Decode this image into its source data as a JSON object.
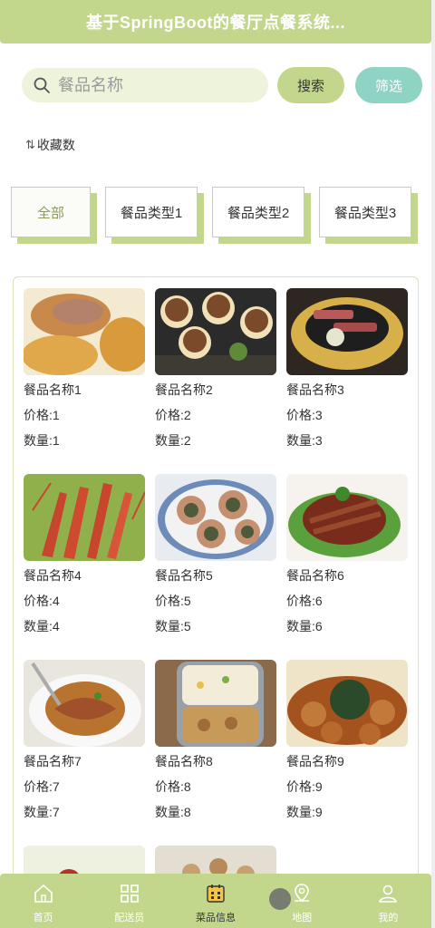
{
  "header": {
    "title": "基于SpringBoot的餐厅点餐系统..."
  },
  "search": {
    "placeholder": "餐品名称",
    "search_label": "搜索",
    "filter_label": "筛选"
  },
  "sort": {
    "label": "收藏数"
  },
  "tabs": [
    {
      "label": "全部",
      "active": true
    },
    {
      "label": "餐品类型1",
      "active": false
    },
    {
      "label": "餐品类型2",
      "active": false
    },
    {
      "label": "餐品类型3",
      "active": false
    }
  ],
  "dishes": [
    {
      "name": "餐品名称1",
      "price": "价格:1",
      "qty": "数量:1"
    },
    {
      "name": "餐品名称2",
      "price": "价格:2",
      "qty": "数量:2"
    },
    {
      "name": "餐品名称3",
      "price": "价格:3",
      "qty": "数量:3"
    },
    {
      "name": "餐品名称4",
      "price": "价格:4",
      "qty": "数量:4"
    },
    {
      "name": "餐品名称5",
      "price": "价格:5",
      "qty": "数量:5"
    },
    {
      "name": "餐品名称6",
      "price": "价格:6",
      "qty": "数量:6"
    },
    {
      "name": "餐品名称7",
      "price": "价格:7",
      "qty": "数量:7"
    },
    {
      "name": "餐品名称8",
      "price": "价格:8",
      "qty": "数量:8"
    },
    {
      "name": "餐品名称9",
      "price": "价格:9",
      "qty": "数量:9"
    }
  ],
  "nav": [
    {
      "label": "首页",
      "icon": "home-icon",
      "active": false
    },
    {
      "label": "配送员",
      "icon": "grid-icon",
      "active": false
    },
    {
      "label": "菜品信息",
      "icon": "menu-calendar-icon",
      "active": true
    },
    {
      "label": "地图",
      "icon": "map-pin-icon",
      "active": false
    },
    {
      "label": "我的",
      "icon": "user-icon",
      "active": false
    }
  ],
  "colors": {
    "accent": "#c3d78c",
    "filter": "#8fd3c4",
    "search_bg": "#eef3dc"
  }
}
